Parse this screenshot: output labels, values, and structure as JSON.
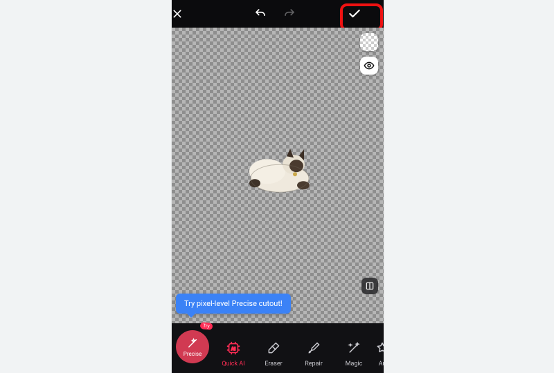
{
  "topbar": {
    "close_label": "Close",
    "undo_label": "Undo",
    "redo_label": "Redo",
    "confirm_label": "Apply"
  },
  "canvas": {
    "bg_toggle_label": "Background",
    "preview_label": "Preview",
    "compare_label": "Compare",
    "subject_label": "Cutout subject"
  },
  "tooltip": {
    "text": "Try pixel-level Precise cutout!"
  },
  "toolbar": {
    "precise": {
      "label": "Precise",
      "badge": "Try"
    },
    "quickai": {
      "label": "Quick AI"
    },
    "eraser": {
      "label": "Eraser"
    },
    "repair": {
      "label": "Repair"
    },
    "magic": {
      "label": "Magic"
    },
    "auto": {
      "label": "Au"
    }
  },
  "colors": {
    "accent": "#ff2d55",
    "tooltip": "#3b82f6",
    "highlight_ring": "#e11"
  }
}
